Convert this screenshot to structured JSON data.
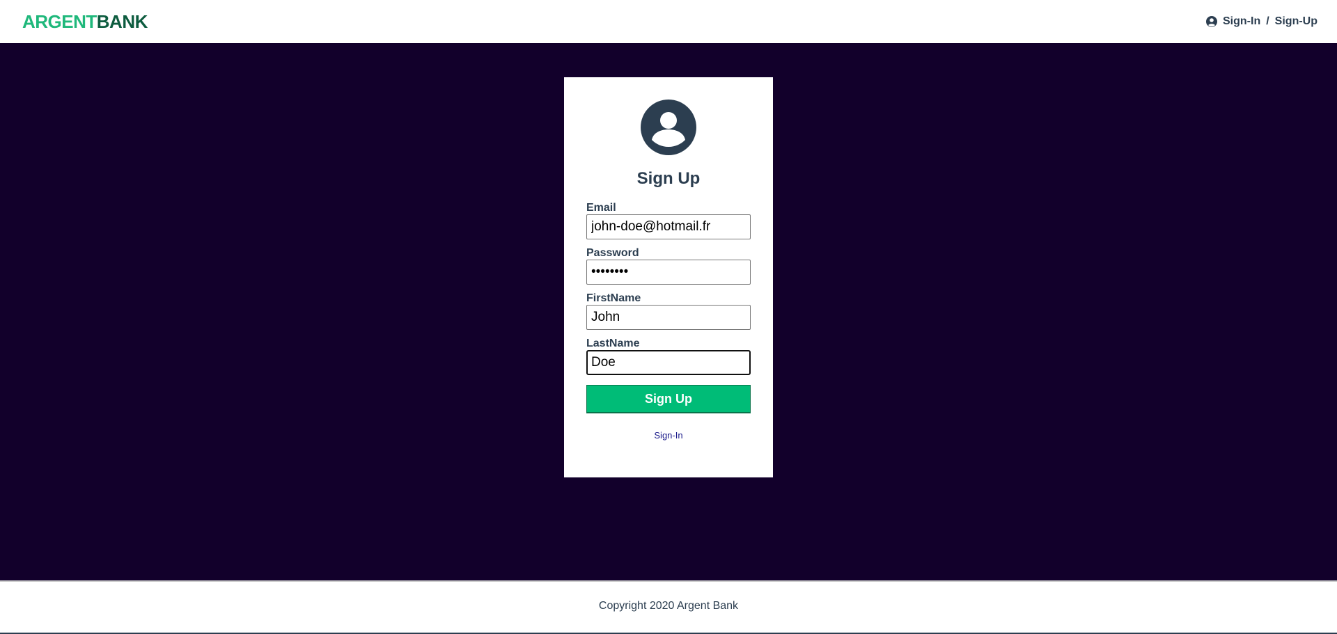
{
  "header": {
    "logo": {
      "part1": "ARGENT",
      "part2": "BANK"
    },
    "nav": {
      "icon": "user-circle-icon",
      "signin_label": "Sign-In",
      "separator": "/",
      "signup_label": "Sign-Up"
    }
  },
  "card": {
    "avatar_icon": "user-circle-icon",
    "title": "Sign Up",
    "fields": {
      "email": {
        "label": "Email",
        "value": "john-doe@hotmail.fr"
      },
      "password": {
        "label": "Password",
        "value": "••••••••"
      },
      "firstname": {
        "label": "FirstName",
        "value": "John"
      },
      "lastname": {
        "label": "LastName",
        "value": "Doe"
      }
    },
    "submit_label": "Sign Up",
    "signin_link": "Sign-In"
  },
  "footer": {
    "text": "Copyright 2020 Argent Bank"
  },
  "colors": {
    "brand_green": "#00bc77",
    "logo_dark_green": "#0d5c3f",
    "main_background": "#12002b",
    "text_dark": "#2c3e50"
  }
}
